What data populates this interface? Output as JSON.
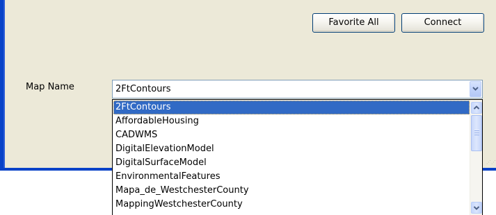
{
  "toolbar": {
    "favorite_all_label": "Favorite All",
    "connect_label": "Connect"
  },
  "map_name": {
    "label": "Map Name",
    "selected_value": "2FtContours",
    "options": [
      "2FtContours",
      "AffordableHousing",
      "CADWMS",
      "DigitalElevationModel",
      "DigitalSurfaceModel",
      "EnvironmentalFeatures",
      "Mapa_de_WestchesterCounty",
      "MappingWestchesterCounty"
    ],
    "highlighted_index": 0
  },
  "icons": {
    "combo_arrow": "chevron-down-icon",
    "scroll_up": "chevron-up-icon",
    "scroll_down": "chevron-down-icon"
  },
  "colors": {
    "window_frame": "#0842c8",
    "dialog_background": "#ece9d8",
    "selection_highlight": "#316ac5"
  }
}
